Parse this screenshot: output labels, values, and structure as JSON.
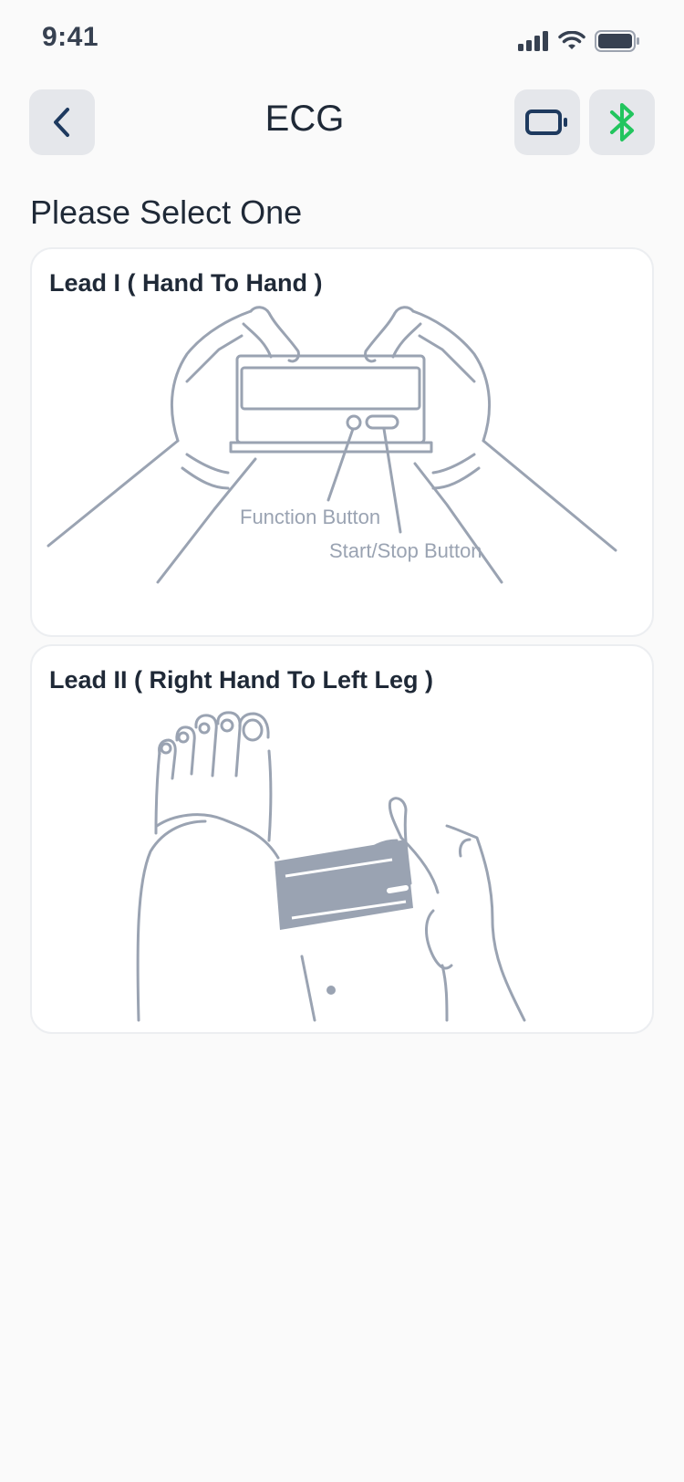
{
  "status_bar": {
    "time": "9:41",
    "icons": [
      "signal-icon",
      "wifi-icon",
      "battery-icon"
    ]
  },
  "nav": {
    "title": "ECG",
    "back_icon": "chevron-left-icon",
    "device_icon": "device-battery-icon",
    "bluetooth_icon": "bluetooth-icon"
  },
  "content": {
    "section_title": "Please Select One",
    "options": [
      {
        "title": "Lead I ( Hand To Hand )",
        "labels": {
          "function_button": "Function Button",
          "start_stop_button": "Start/Stop Button"
        }
      },
      {
        "title": "Lead II ( Right Hand To Left Leg )"
      }
    ]
  },
  "colors": {
    "background": "#fafafa",
    "icon_button_bg": "#e5e7eb",
    "nav_icon": "#1e3a5f",
    "bluetooth": "#22c55e",
    "illustration_stroke": "#9aa3b2"
  }
}
